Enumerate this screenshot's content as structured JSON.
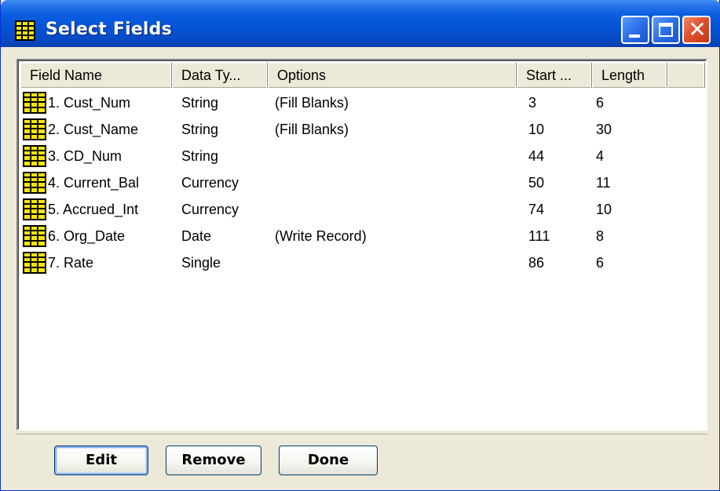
{
  "window": {
    "title": "Select Fields",
    "icon": "table-grid-icon"
  },
  "titlebar_buttons": {
    "minimize_icon": "minimize-icon",
    "maximize_icon": "maximize-icon",
    "close_icon": "close-icon",
    "close_glyph": "✕"
  },
  "list": {
    "columns": [
      "Field Name",
      "Data Ty...",
      "Options",
      "Start ...",
      "Length"
    ],
    "rows": [
      {
        "field": "1. Cust_Num",
        "type": "String",
        "options": "(Fill Blanks)",
        "start": "3",
        "length": "6"
      },
      {
        "field": "2. Cust_Name",
        "type": "String",
        "options": "(Fill Blanks)",
        "start": "10",
        "length": "30"
      },
      {
        "field": "3. CD_Num",
        "type": "String",
        "options": "",
        "start": "44",
        "length": "4"
      },
      {
        "field": "4. Current_Bal",
        "type": "Currency",
        "options": "",
        "start": "50",
        "length": "11"
      },
      {
        "field": "5. Accrued_Int",
        "type": "Currency",
        "options": "",
        "start": "74",
        "length": "10"
      },
      {
        "field": "6. Org_Date",
        "type": "Date",
        "options": "(Write Record)",
        "start": "111",
        "length": "8"
      },
      {
        "field": "7. Rate",
        "type": "Single",
        "options": "",
        "start": "86",
        "length": "6"
      }
    ],
    "row_icon": "field-grid-icon"
  },
  "buttons": {
    "edit": "Edit",
    "remove": "Remove",
    "done": "Done"
  },
  "colors": {
    "titlebar": "#0554d7",
    "icon_yellow": "#f7e600",
    "close_red": "#e0522d"
  }
}
